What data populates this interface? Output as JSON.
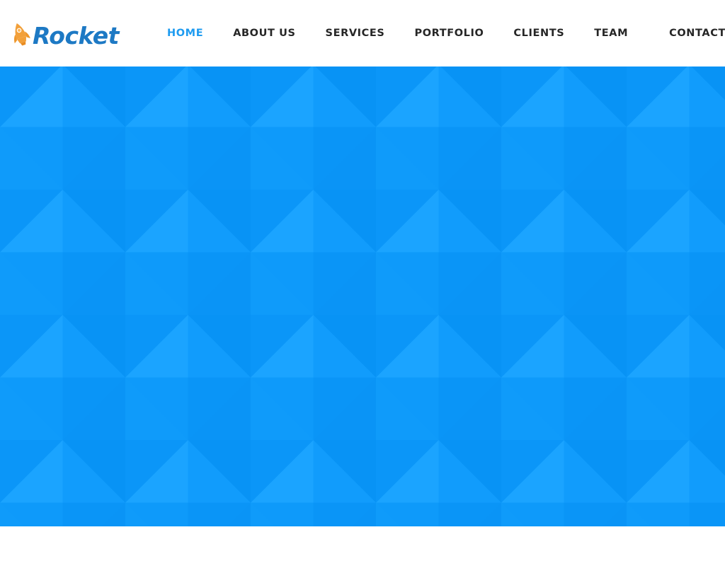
{
  "header": {
    "brand": {
      "icon": "rocket-icon",
      "icon_color": "#F5A12E",
      "text": "Rocket",
      "text_color": "#1D79C4"
    },
    "nav": {
      "active_color": "#1E9BF0",
      "inactive_color": "#262626",
      "items": [
        {
          "label": "HOME",
          "active": true
        },
        {
          "label": "ABOUT US",
          "active": false
        },
        {
          "label": "SERVICES",
          "active": false
        },
        {
          "label": "PORTFOLIO",
          "active": false
        },
        {
          "label": "CLIENTS",
          "active": false
        },
        {
          "label": "TEAM",
          "active": false
        },
        {
          "label": "CONTACT",
          "active": false
        }
      ]
    }
  },
  "hero": {
    "background_color": "#0D99FA",
    "pattern": "diamond-tiles",
    "pattern_shade_light": "#1AA3FF",
    "pattern_shade_mid": "#0D99FA",
    "pattern_shade_dark": "#0891F2",
    "content": ""
  },
  "page": {
    "background_color": "#FFFFFF"
  }
}
